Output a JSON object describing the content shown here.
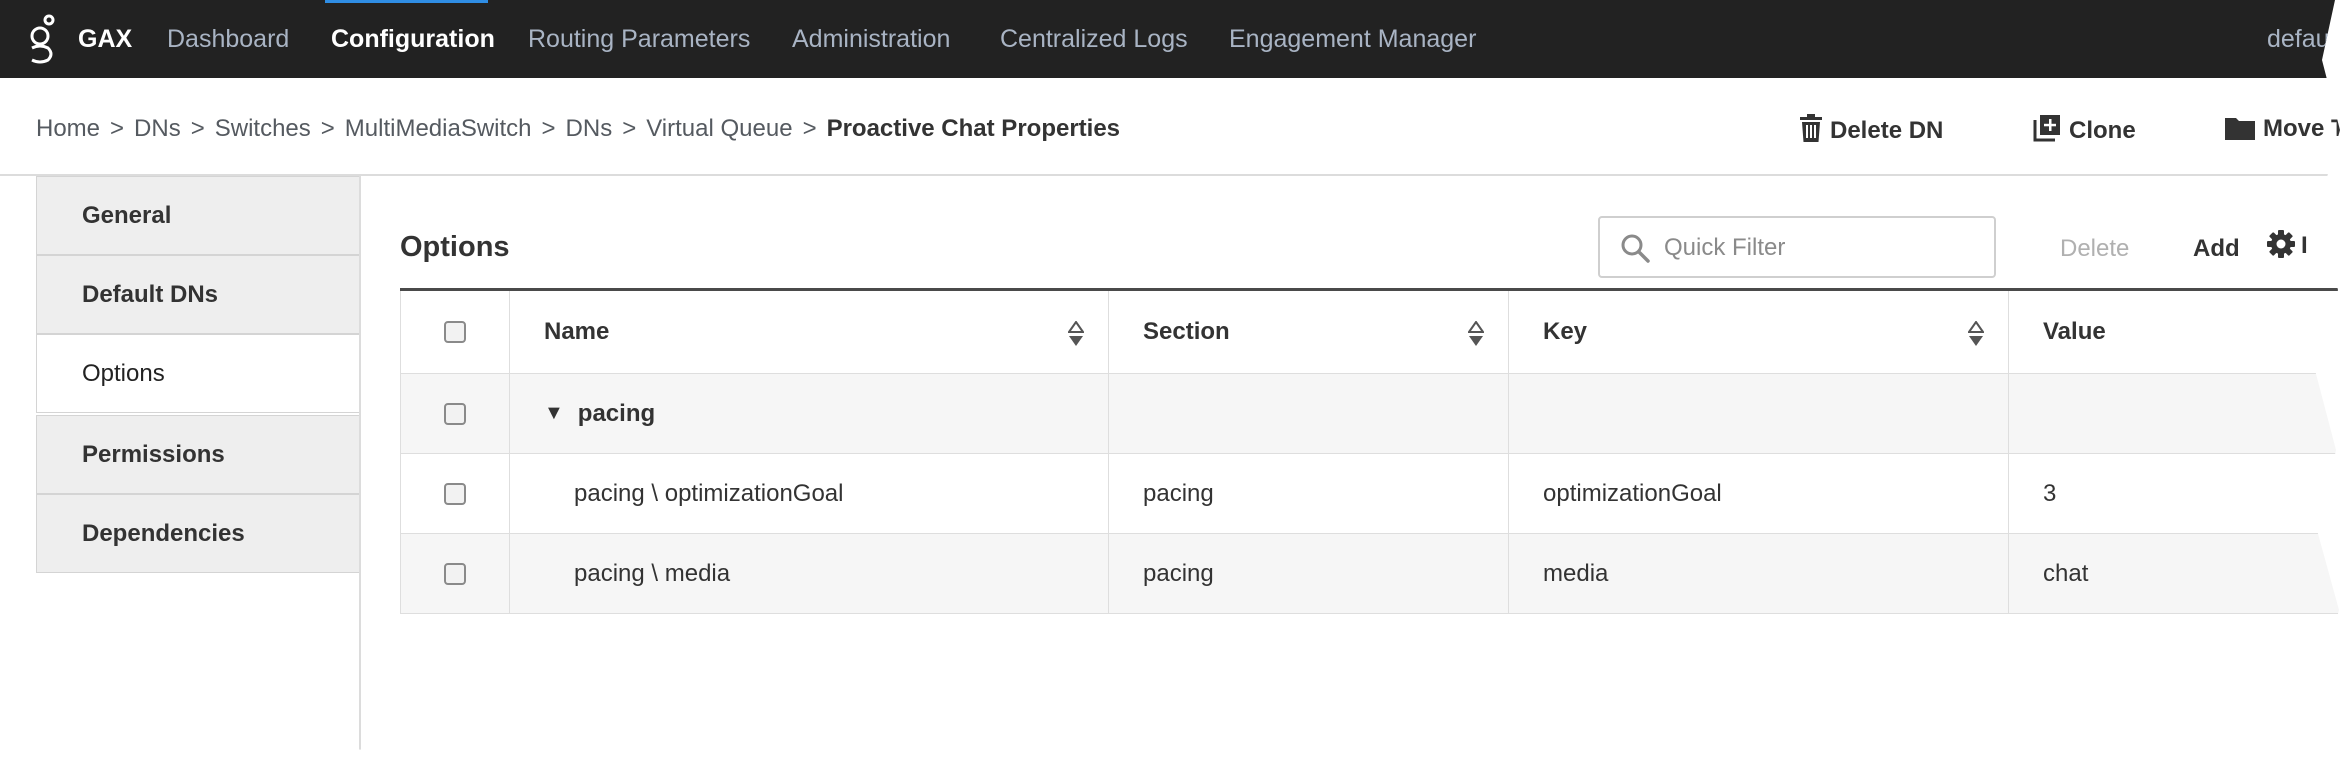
{
  "topbar": {
    "brand": "GAX",
    "nav": [
      {
        "label": "Dashboard",
        "active": false
      },
      {
        "label": "Configuration",
        "active": true
      },
      {
        "label": "Routing Parameters",
        "active": false
      },
      {
        "label": "Administration",
        "active": false
      },
      {
        "label": "Centralized Logs",
        "active": false
      },
      {
        "label": "Engagement Manager",
        "active": false
      }
    ],
    "user": "defau"
  },
  "breadcrumb": {
    "items": [
      "Home",
      "DNs",
      "Switches",
      "MultiMediaSwitch",
      "DNs",
      "Virtual Queue"
    ],
    "separator": ">",
    "current": "Proactive Chat Properties"
  },
  "actions": {
    "delete_dn": "Delete DN",
    "clone": "Clone",
    "move": "Move T"
  },
  "sidebar": {
    "items": [
      {
        "label": "General"
      },
      {
        "label": "Default DNs"
      },
      {
        "label": "Options",
        "selected": true
      },
      {
        "label": "Permissions"
      },
      {
        "label": "Dependencies"
      }
    ]
  },
  "panel": {
    "title": "Options",
    "filter_placeholder": "Quick Filter",
    "delete_label": "Delete",
    "add_label": "Add",
    "more_label": "I"
  },
  "table": {
    "columns": [
      "Name",
      "Section",
      "Key",
      "Value"
    ],
    "group": {
      "label": "pacing"
    },
    "rows": [
      {
        "name": "pacing \\ optimizationGoal",
        "section": "pacing",
        "key": "optimizationGoal",
        "value": "3"
      },
      {
        "name": "pacing \\ media",
        "section": "pacing",
        "key": "media",
        "value": "chat"
      }
    ]
  },
  "colors": {
    "topbar_bg": "#222222",
    "nav_inactive": "#a9b4c4",
    "active_indicator": "#2f8de4"
  }
}
